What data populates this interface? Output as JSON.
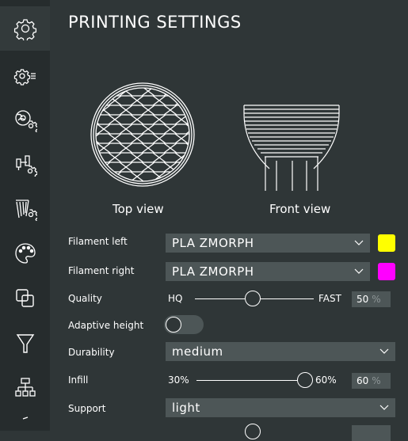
{
  "header": {
    "title": "PRINTING SETTINGS"
  },
  "sidebar": {
    "items": [
      {
        "icon": "gear-icon"
      },
      {
        "icon": "gear-list-icon"
      },
      {
        "icon": "filament-spool-gear-icon"
      },
      {
        "icon": "toolhead-gear-icon"
      },
      {
        "icon": "infill-gear-icon"
      },
      {
        "icon": "palette-icon"
      },
      {
        "icon": "layers-icon"
      },
      {
        "icon": "funnel-icon"
      },
      {
        "icon": "network-icon"
      }
    ]
  },
  "views": {
    "top_label": "Top view",
    "front_label": "Front view"
  },
  "settings": {
    "filament_left": {
      "label": "Filament left",
      "value": "PLA ZMORPH",
      "color": "#ffff00"
    },
    "filament_right": {
      "label": "Filament right",
      "value": "PLA ZMORPH",
      "color": "#ff00ff"
    },
    "quality": {
      "label": "Quality",
      "min_label": "HQ",
      "max_label": "FAST",
      "value": "50",
      "unit": "%"
    },
    "adaptive_height": {
      "label": "Adaptive height",
      "enabled": false
    },
    "durability": {
      "label": "Durability",
      "value": "medium"
    },
    "infill": {
      "label": "Infill",
      "min_label": "30%",
      "max_label": "60%",
      "value": "60",
      "unit": "%"
    },
    "support": {
      "label": "Support",
      "value": "light"
    }
  },
  "colors": {
    "background": "#2f3637",
    "sidebar": "#262c2d",
    "field": "#4d5657"
  }
}
